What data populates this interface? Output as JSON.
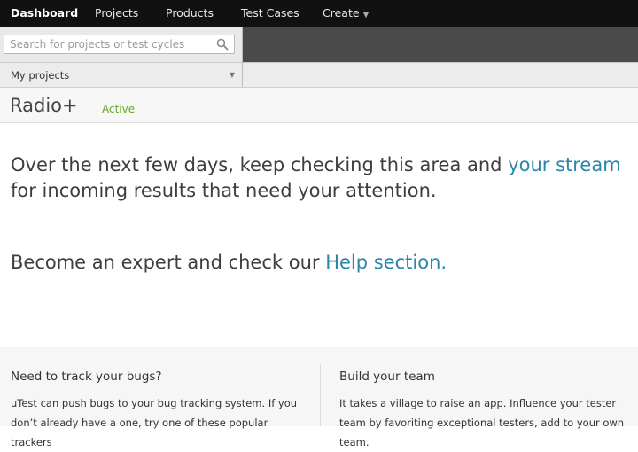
{
  "nav": {
    "dashboard": "Dashboard",
    "projects": "Projects",
    "products": "Products",
    "test_cases": "Test Cases",
    "create": "Create"
  },
  "search": {
    "placeholder": "Search for projects or test cycles",
    "value": ""
  },
  "projects_dropdown": {
    "label": "My projects"
  },
  "project": {
    "title": "Radio+",
    "status": "Active"
  },
  "message": {
    "line1_prefix": "Over the next few days, keep checking this area and ",
    "line1_link": "your stream",
    "line1_suffix": " for incoming results that need your attention.",
    "line2_prefix": "Become an expert and check our ",
    "line2_link": "Help section."
  },
  "bottom": {
    "bugs_title": "Need to track your bugs?",
    "bugs_text": "uTest can push bugs to your bug tracking system. If you don’t already have a one, try one of these popular trackers",
    "team_title": "Build your team",
    "team_text": "It takes a village to raise an app. Influence your tester team by favoriting exceptional testers, add to your own team."
  },
  "colors": {
    "nav_bg": "#111111",
    "link": "#2a86a8",
    "status_active": "#6aa52b"
  },
  "icons": {
    "search": "search-icon",
    "create_caret": "caret-down-icon",
    "dropdown": "triangle-down-icon"
  }
}
